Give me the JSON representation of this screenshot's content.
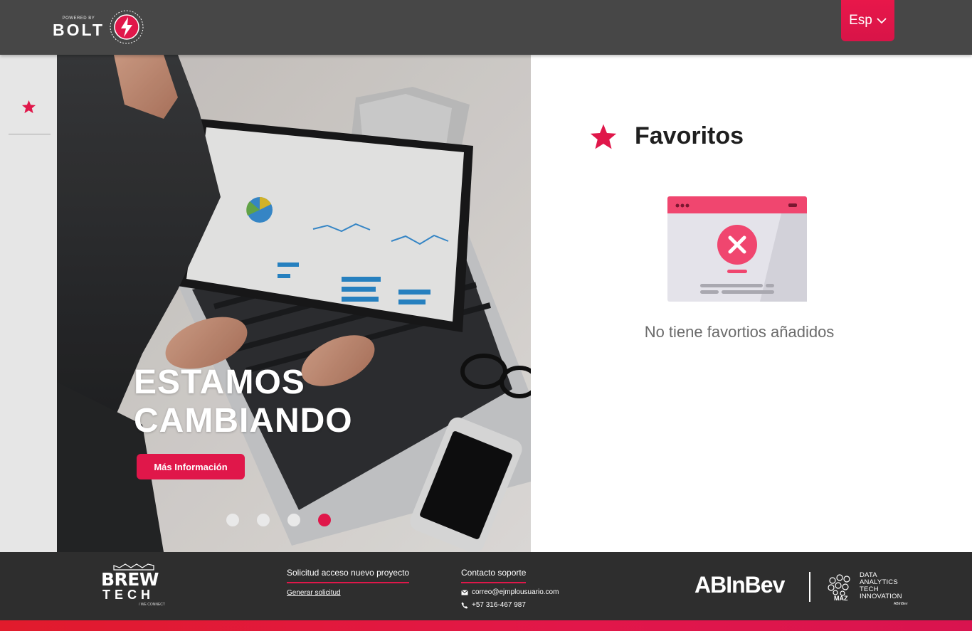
{
  "header": {
    "logo_powered_by": "POWERED BY",
    "logo_name": "BOLT",
    "language_label": "Esp"
  },
  "sidebar": {
    "items": [
      {
        "icon": "star-icon",
        "label": "Favoritos"
      }
    ]
  },
  "hero": {
    "title_line1": "ESTAMOS",
    "title_line2": "CAMBIANDO",
    "button_label": "Más Información",
    "slides": {
      "count": 4,
      "active_index": 3
    }
  },
  "favorites": {
    "title": "Favoritos",
    "empty_message": "No tiene favortios añadidos"
  },
  "footer": {
    "brand_top": "BREW",
    "brand_bottom": "TECH",
    "brand_sub": "/ WE CONNECT",
    "request_heading": "Solicitud acceso nuevo proyecto",
    "request_link": "Generar solicitud",
    "support_heading": "Contacto soporte",
    "support_email": "correo@ejmplousuario.com",
    "support_phone": "+57 316-467 987",
    "partner_logo": "ABInBev",
    "maz_text": [
      "DATA",
      "ANALYTICS",
      "TECH",
      "INNOVATION"
    ],
    "maz_label": "MAZ",
    "maz_sub": "ABInBev"
  },
  "colors": {
    "accent": "#e0174a",
    "header_bg": "#474747",
    "footer_bg": "#2e2e2e",
    "rail_bg": "#e6e6e6"
  }
}
